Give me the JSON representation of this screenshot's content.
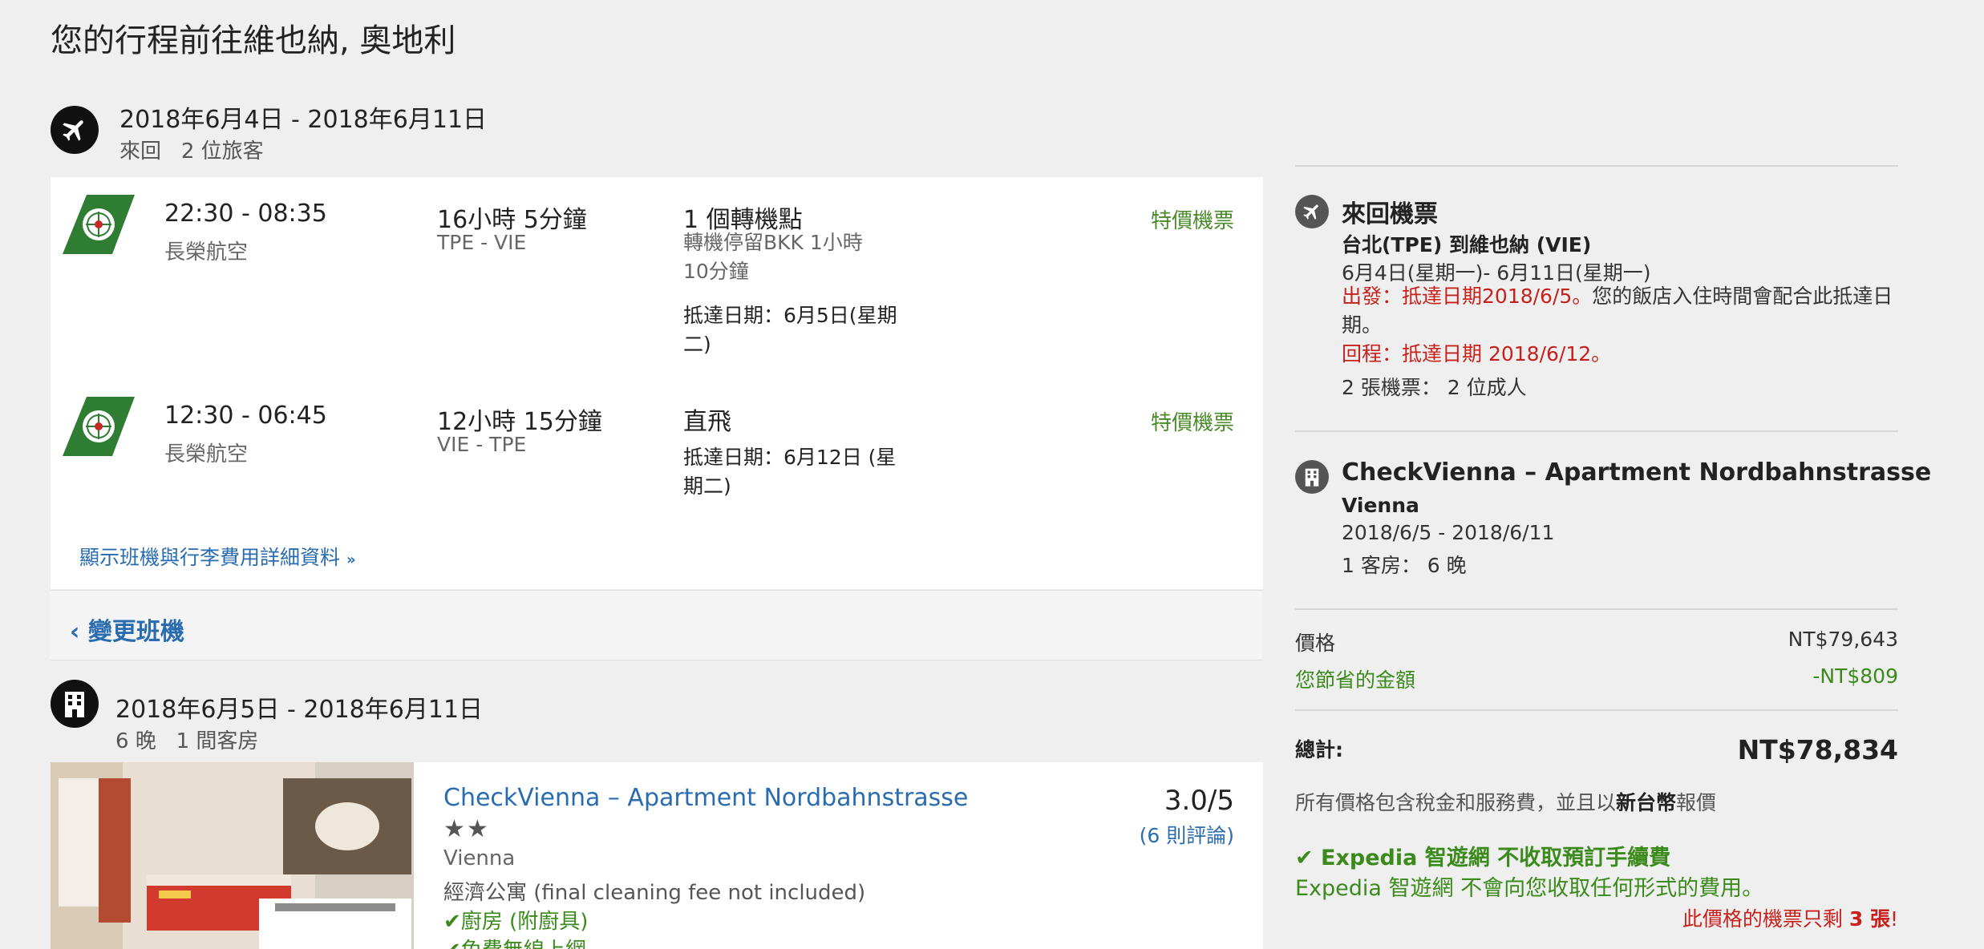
{
  "page": {
    "title": "您的行程前往維也納, 奧地利"
  },
  "flight_section": {
    "icon": "airplane-icon",
    "dates": "2018年6月4日 - 2018年6月11日",
    "trip_type": "來回",
    "travelers": "2 位旅客",
    "legs": [
      {
        "times": "22:30 - 08:35",
        "airline": "長榮航空",
        "duration": "16小時 5分鐘",
        "route": "TPE - VIE",
        "stops": "1 個轉機點",
        "layover": "轉機停留BKK 1小時 10分鐘",
        "arrival": "抵達日期：6月5日(星期二)",
        "deal": "特價機票"
      },
      {
        "times": "12:30 - 06:45",
        "airline": "長榮航空",
        "duration": "12小時 15分鐘",
        "route": "VIE - TPE",
        "stops": "直飛",
        "layover": "",
        "arrival": "抵達日期：6月12日 (星期二)",
        "deal": "特價機票"
      }
    ],
    "details_link": "顯示班機與行李費用詳細資料",
    "details_icon": "double-chevron-down-icon",
    "change_link": "變更班機",
    "change_icon": "chevron-left-icon"
  },
  "hotel_section": {
    "icon": "building-icon",
    "dates": "2018年6月5日 - 2018年6月11日",
    "nights": "6 晚",
    "rooms": "1 間客房",
    "hotel": {
      "name": "CheckVienna – Apartment Nordbahnstrasse",
      "stars": "★★",
      "star_count": 2,
      "city": "Vienna",
      "type": "經濟公寓 (final cleaning fee not included)",
      "amenities": [
        "廚房 (附廚具)",
        "免費無線上網"
      ],
      "amenity_icon": "checkmark-icon",
      "rating": "3.0/5",
      "reviews": "(6 則評論)"
    }
  },
  "summary": {
    "flight": {
      "icon": "airplane-icon",
      "title": "來回機票",
      "route": "台北(TPE) 到維也納 (VIE)",
      "dates": "6月4日(星期一)- 6月11日(星期一)",
      "outbound_label": "出發：",
      "outbound_note": "抵達日期2018/6/5。",
      "outbound_note_black": "您的飯店入住時間會配合此抵達日期。",
      "return_label": "回程：",
      "return_note": "抵達日期 2018/6/12。",
      "tickets": "2 張機票： 2 位成人"
    },
    "hotel": {
      "icon": "building-icon",
      "name": "CheckVienna – Apartment Nordbahnstrasse",
      "city": "Vienna",
      "dates": "2018/6/5 - 2018/6/11",
      "rooms_nights": "1 客房： 6 晚"
    },
    "price_label": "價格",
    "price_value": "NT$79,643",
    "savings_label": "您節省的金額",
    "savings_value": "-NT$809",
    "total_label": "總計:",
    "total_value": "NT$78,834",
    "note_prefix": "所有價格包含稅金和服務費，並且以",
    "note_currency": "新台幣",
    "note_suffix": "報價",
    "nofee_title": "Expedia 智遊網 不收取預訂手續費",
    "nofee_icon": "checkmark-icon",
    "nofee_text": "Expedia 智遊網 不會向您收取任何形式的費用。",
    "seats_prefix": "此價格的機票只剩 ",
    "seats_count": "3 張",
    "seats_suffix": "!"
  },
  "colors": {
    "background": "#efefef",
    "link_blue": "#2a6cb0",
    "deal_green": "#4a8a2a",
    "alert_red": "#c8201b",
    "airline_green": "#2e7d32"
  }
}
